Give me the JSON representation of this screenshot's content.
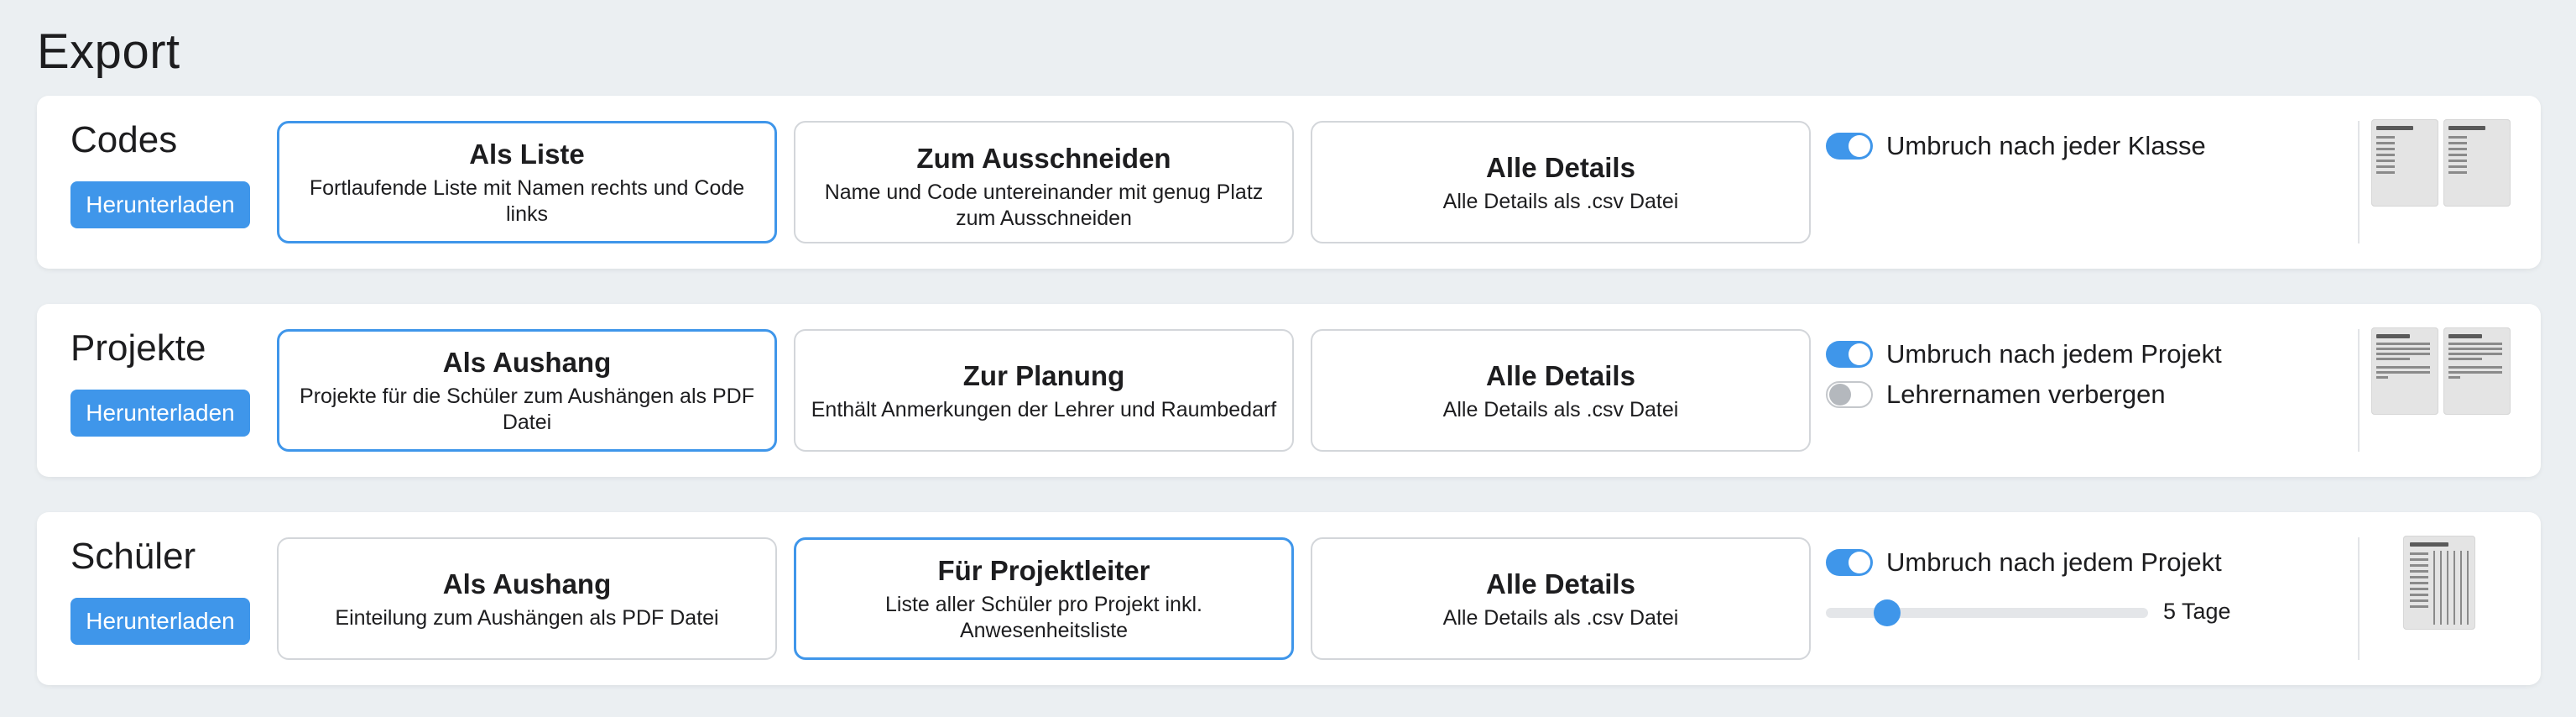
{
  "page_title": "Export",
  "colors": {
    "accent": "#3f96ea",
    "background": "#ebeff2",
    "card": "#ffffff"
  },
  "sections": [
    {
      "title": "Codes",
      "download_label": "Herunterladen",
      "options": [
        {
          "title": "Als Liste",
          "desc": "Fortlaufende Liste mit Namen rechts und Code links",
          "selected": true
        },
        {
          "title": "Zum Ausschneiden",
          "desc": "Name und Code untereinander mit genug Platz zum Ausschneiden",
          "selected": false
        },
        {
          "title": "Alle Details",
          "desc": "Alle Details als .csv Datei",
          "selected": false
        }
      ],
      "toggles": [
        {
          "label": "Umbruch nach jeder Klasse",
          "on": true
        }
      ],
      "preview": "two-page-list-preview"
    },
    {
      "title": "Projekte",
      "download_label": "Herunterladen",
      "options": [
        {
          "title": "Als Aushang",
          "desc": "Projekte für die Schüler zum Aushängen als PDF Datei",
          "selected": true
        },
        {
          "title": "Zur Planung",
          "desc": "Enthält Anmerkungen der Lehrer und Raumbedarf",
          "selected": false
        },
        {
          "title": "Alle Details",
          "desc": "Alle Details als .csv Datei",
          "selected": false
        }
      ],
      "toggles": [
        {
          "label": "Umbruch nach jedem Projekt",
          "on": true
        },
        {
          "label": "Lehrernamen verbergen",
          "on": false
        }
      ],
      "preview": "two-page-text-preview"
    },
    {
      "title": "Schüler",
      "download_label": "Herunterladen",
      "options": [
        {
          "title": "Als Aushang",
          "desc": "Einteilung zum Aushängen als PDF Datei",
          "selected": false
        },
        {
          "title": "Für Projektleiter",
          "desc": "Liste aller Schüler pro Projekt inkl. Anwesenheitsliste",
          "selected": true
        },
        {
          "title": "Alle Details",
          "desc": "Alle Details als .csv Datei",
          "selected": false
        }
      ],
      "toggles": [
        {
          "label": "Umbruch nach jedem Projekt",
          "on": true
        }
      ],
      "slider": {
        "value_label": "5 Tage",
        "fraction": 0.19
      },
      "preview": "attendance-table-preview"
    }
  ]
}
